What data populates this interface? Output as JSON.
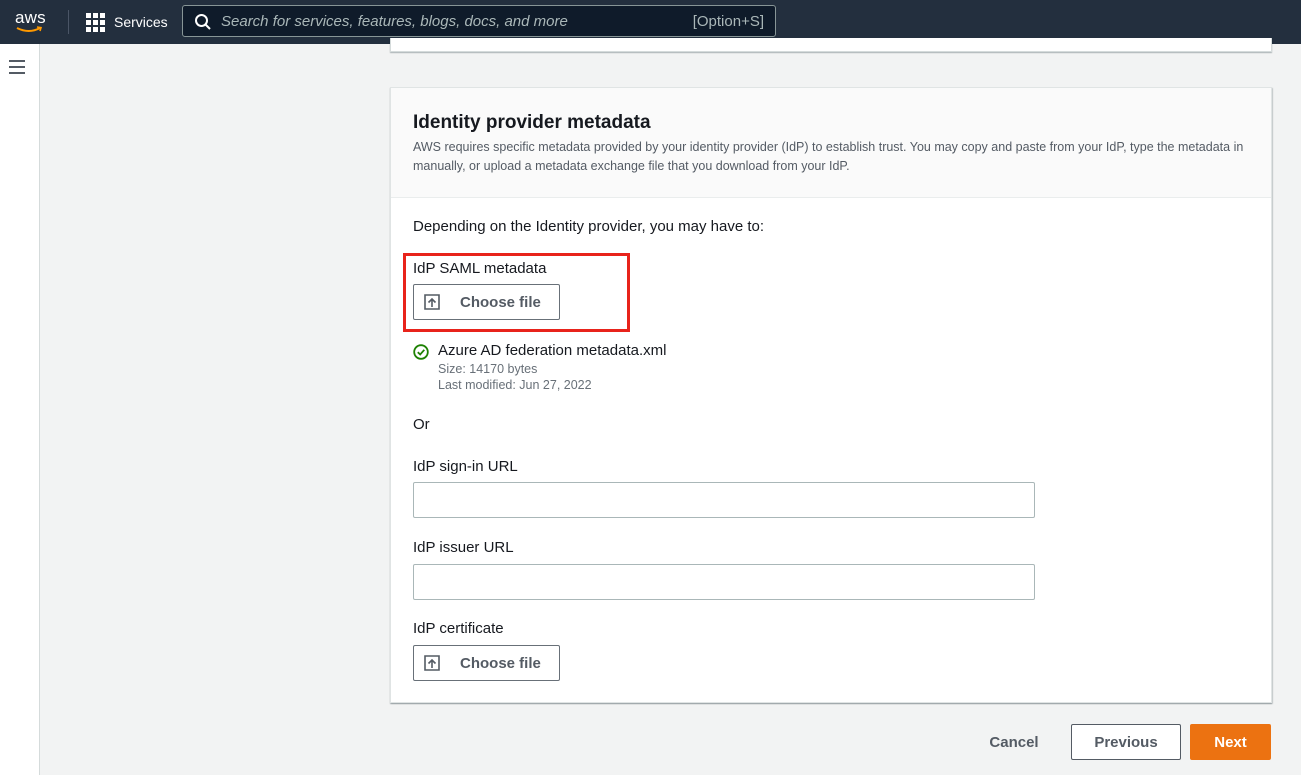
{
  "nav": {
    "logo_text": "aws",
    "services_label": "Services",
    "search_placeholder": "Search for services, features, blogs, docs, and more",
    "search_shortcut": "[Option+S]"
  },
  "panel": {
    "title": "Identity provider metadata",
    "description": "AWS requires specific metadata provided by your identity provider (IdP) to establish trust. You may copy and paste from your IdP, type the metadata in manually, or upload a metadata exchange file that you download from your IdP.",
    "intro": "Depending on the Identity provider, you may have to:",
    "saml_label": "IdP SAML metadata",
    "choose_file_label": "Choose file",
    "uploaded_file": {
      "name": "Azure AD federation metadata.xml",
      "size": "Size: 14170 bytes",
      "modified": "Last modified: Jun 27, 2022"
    },
    "or_text": "Or",
    "signin_url_label": "IdP sign-in URL",
    "signin_url_value": "",
    "issuer_url_label": "IdP issuer URL",
    "issuer_url_value": "",
    "certificate_label": "IdP certificate",
    "certificate_button_label": "Choose file"
  },
  "footer": {
    "cancel_label": "Cancel",
    "previous_label": "Previous",
    "next_label": "Next"
  },
  "colors": {
    "nav_bg": "#232f3e",
    "primary": "#ec7211",
    "highlight": "#e8231b",
    "success": "#1d8102"
  },
  "icons": [
    "aws-logo",
    "grid-icon",
    "search-icon",
    "hamburger-menu-icon",
    "upload-icon",
    "success-check-icon"
  ]
}
